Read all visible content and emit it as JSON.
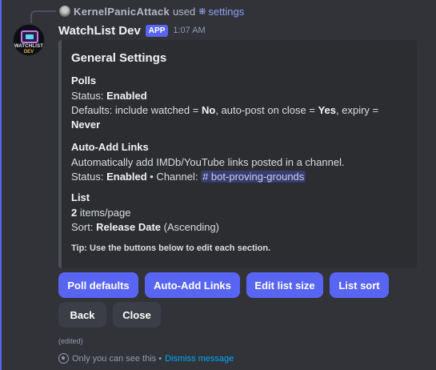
{
  "reply": {
    "username": "KernelPanicAttack",
    "used_text": "used",
    "command_icon": "slash-command-icon",
    "command_name": "settings"
  },
  "message": {
    "author": "WatchList Dev",
    "badge": "APP",
    "timestamp": "1:07 AM",
    "avatar_text_top": "WATCHLIST",
    "avatar_text_bottom": "DEV",
    "edited": "(edited)"
  },
  "embed": {
    "border_color": "#4e5058",
    "title": "General Settings",
    "polls": {
      "title": "Polls",
      "status_label": "Status: ",
      "status_value": "Enabled",
      "defaults_prefix": "Defaults: include watched = ",
      "include_watched": "No",
      "auto_post_label": ", auto-post on close = ",
      "auto_post": "Yes",
      "expiry_label": ", expiry = ",
      "expiry": "Never"
    },
    "auto_add": {
      "title": "Auto-Add Links",
      "description": "Automatically add IMDb/YouTube links posted in a channel.",
      "status_label": "Status: ",
      "status_value": "Enabled",
      "channel_sep": " • Channel: ",
      "channel": "# bot-proving-grounds"
    },
    "list": {
      "title": "List",
      "items_per_page_value": "2",
      "items_per_page_suffix": " items/page",
      "sort_label": "Sort: ",
      "sort_value": "Release Date",
      "sort_order": " (Ascending)"
    },
    "tip": "Tip: Use the buttons below to edit each section."
  },
  "buttons": {
    "poll_defaults": "Poll defaults",
    "auto_add_links": "Auto-Add Links",
    "edit_list_size": "Edit list size",
    "list_sort": "List sort",
    "back": "Back",
    "close": "Close"
  },
  "footer": {
    "ephemeral_text": "Only you can see this • ",
    "dismiss": "Dismiss message"
  },
  "colors": {
    "accent": "#5865f2",
    "background": "#323339",
    "embed_background": "#2b2d31",
    "link": "#00a8fc"
  }
}
